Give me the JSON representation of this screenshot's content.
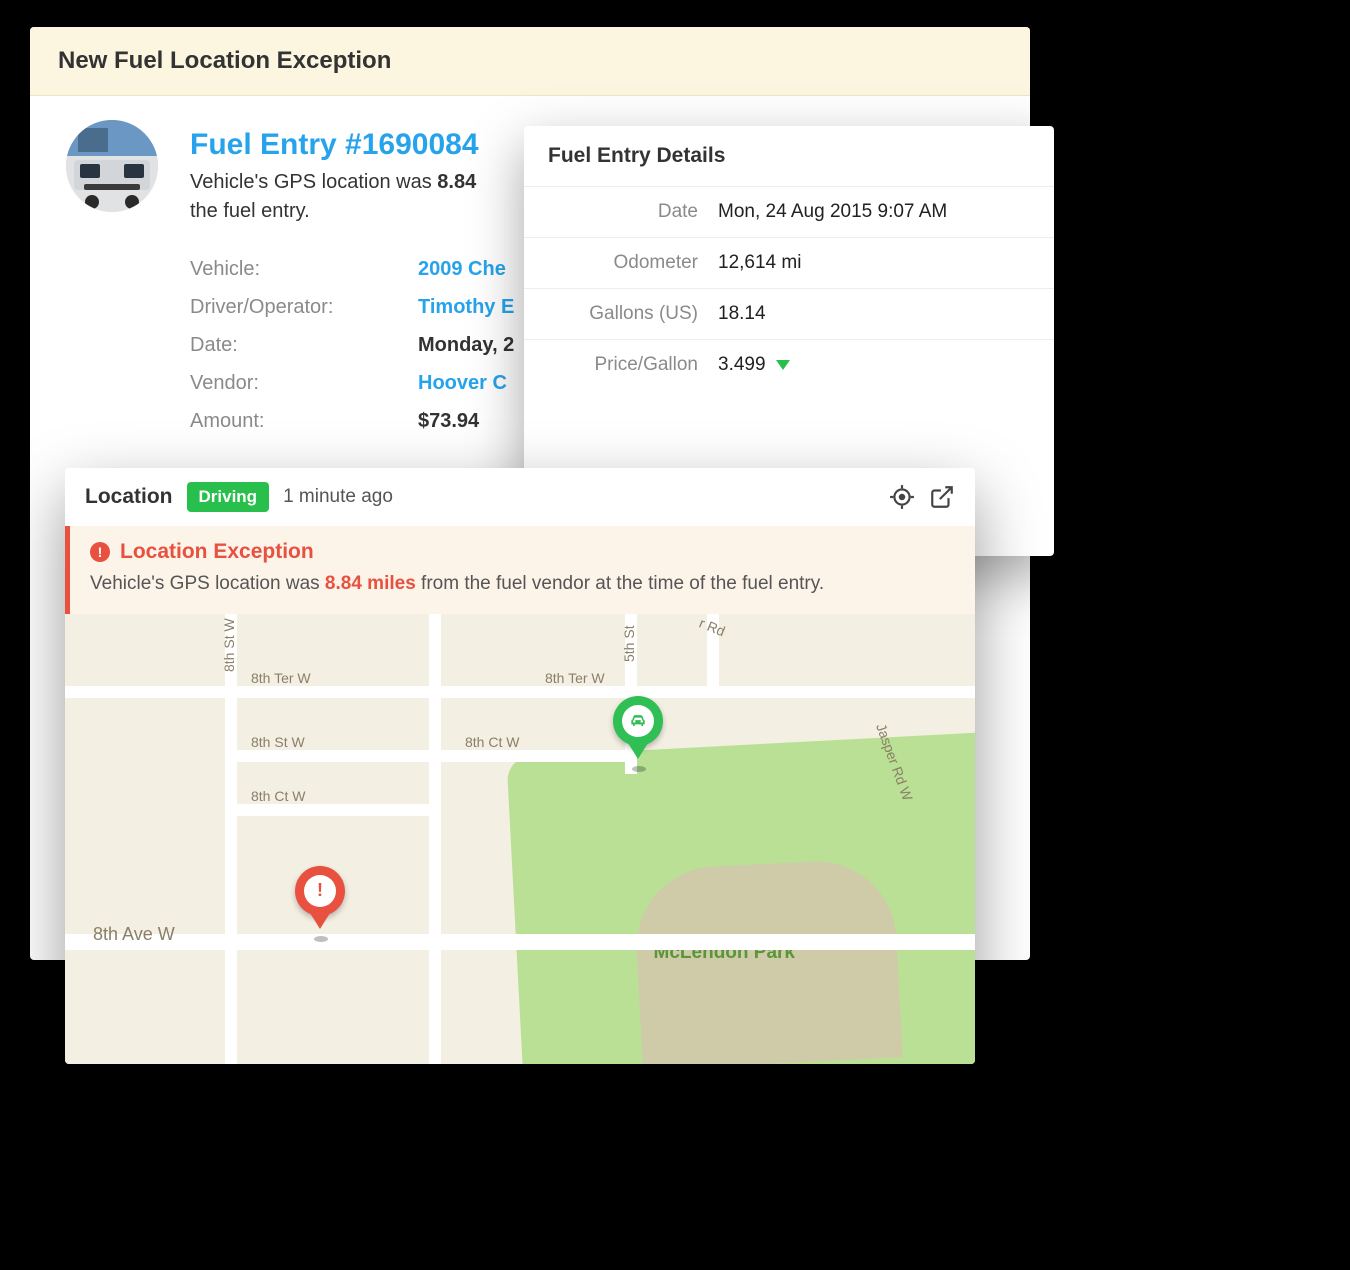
{
  "back": {
    "header_title": "New Fuel Location Exception",
    "entry_title": "Fuel Entry #1690084",
    "desc_prefix": "Vehicle's GPS location was ",
    "desc_bold": "8.84",
    "desc_suffix": "the fuel entry.",
    "fields": {
      "vehicle_label": "Vehicle:",
      "vehicle_value": "2009 Che",
      "driver_label": "Driver/Operator:",
      "driver_value": "Timothy E",
      "date_label": "Date:",
      "date_value": "Monday, 2",
      "vendor_label": "Vendor:",
      "vendor_value": "Hoover C",
      "amount_label": "Amount:",
      "amount_value": "$73.94"
    }
  },
  "details": {
    "title": "Fuel Entry Details",
    "rows": {
      "date_label": "Date",
      "date_value": "Mon, 24 Aug 2015 9:07 AM",
      "odometer_label": "Odometer",
      "odometer_value": "12,614 mi",
      "gallons_label": "Gallons (US)",
      "gallons_value": "18.14",
      "price_label": "Price/Gallon",
      "price_value": "3.499"
    }
  },
  "location": {
    "title": "Location",
    "badge": "Driving",
    "time": "1 minute ago",
    "exc_title": "Location Exception",
    "exc_prefix": "Vehicle's GPS location was ",
    "exc_hl": "8.84 miles",
    "exc_suffix": " from the fuel vendor at the time of the fuel entry."
  },
  "map": {
    "park_label": "McLendon Park",
    "roads": {
      "eighth_st_w": "8th St W",
      "eighth_ter_w": "8th Ter W",
      "eighth_ct_w": "8th Ct W",
      "eighth_ave_w": "8th Ave W",
      "fifth_st": "5th St",
      "her_rd": "r Rd",
      "jasper_rd_w": "Jasper Rd W"
    }
  }
}
